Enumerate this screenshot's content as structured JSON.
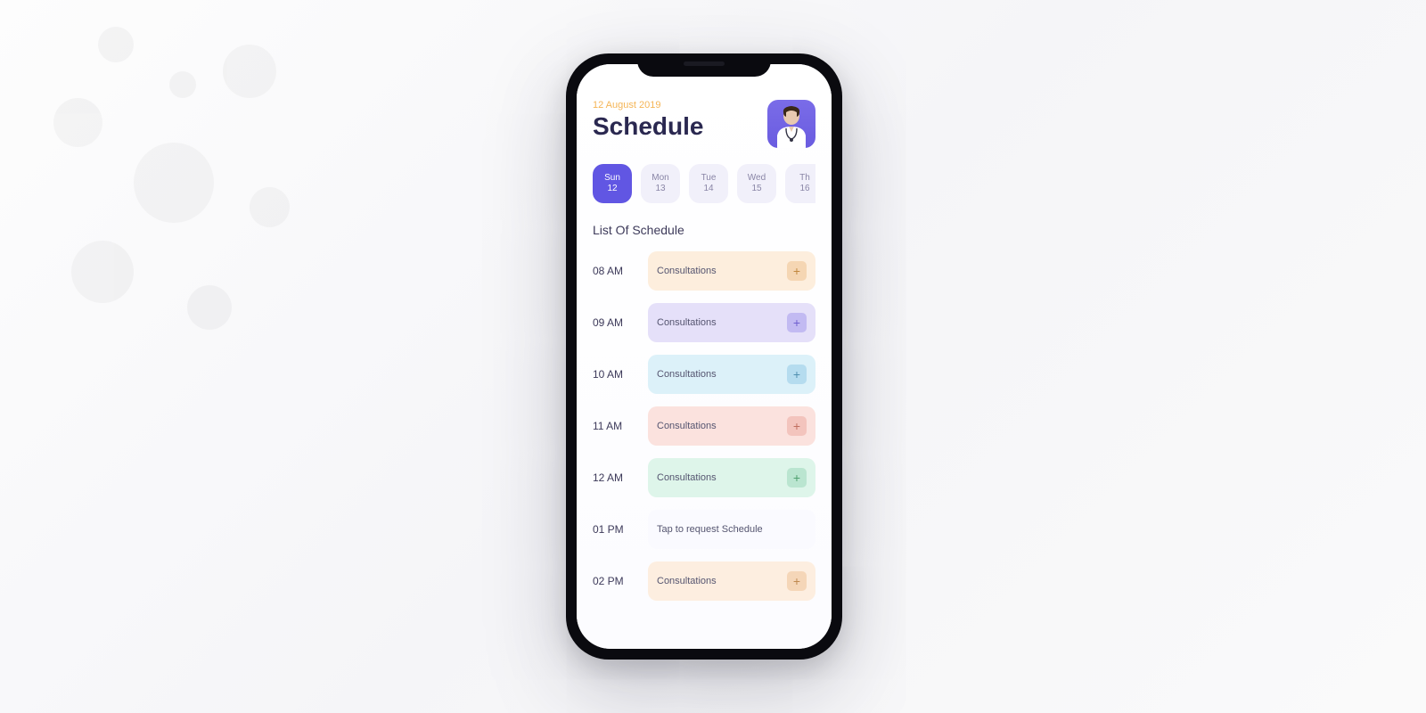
{
  "header": {
    "date": "12 August 2019",
    "title": "Schedule"
  },
  "days": [
    {
      "name": "Sun",
      "num": "12",
      "active": true
    },
    {
      "name": "Mon",
      "num": "13",
      "active": false
    },
    {
      "name": "Tue",
      "num": "14",
      "active": false
    },
    {
      "name": "Wed",
      "num": "15",
      "active": false
    },
    {
      "name": "Th",
      "num": "16",
      "active": false
    }
  ],
  "section_label": "List Of Schedule",
  "empty_slot_text": "Tap to request Schedule",
  "slots": [
    {
      "time": "08 AM",
      "label": "Consultations",
      "color": "orange",
      "has_add": true
    },
    {
      "time": "09 AM",
      "label": "Consultations",
      "color": "violet",
      "has_add": true
    },
    {
      "time": "10 AM",
      "label": "Consultations",
      "color": "cyan",
      "has_add": true
    },
    {
      "time": "11 AM",
      "label": "Consultations",
      "color": "coral",
      "has_add": true
    },
    {
      "time": "12 AM",
      "label": "Consultations",
      "color": "mint",
      "has_add": true
    },
    {
      "time": "01 PM",
      "label": "Tap to request Schedule",
      "color": "empty",
      "has_add": false
    },
    {
      "time": "02 PM",
      "label": "Consultations",
      "color": "peach",
      "has_add": true
    }
  ]
}
